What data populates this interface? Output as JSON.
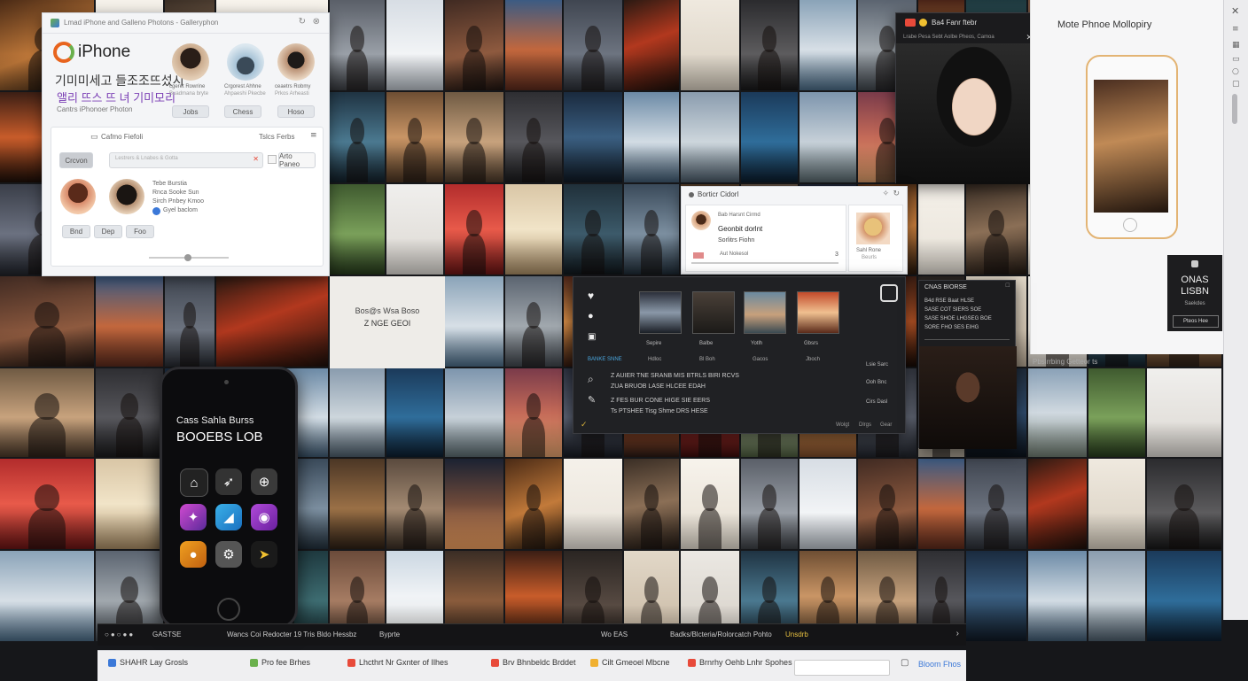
{
  "colors": {
    "accent_orange": "#e8641e",
    "accent_green": "#6ab04c",
    "purple_text": "#7b3fb5",
    "blue_link": "#3b78d8",
    "panel_white": "#f4f5f7",
    "panel_dark": "#222326"
  },
  "tiles": [
    {
      "bg": "linear-gradient(160deg,#4a2a15,#c27a3a 55%,#2a1a0e)",
      "subj": "body"
    },
    {
      "bg": "linear-gradient(180deg,#f5f1ea,#e8e2d8)",
      "subj": "none"
    },
    {
      "bg": "linear-gradient(170deg,#3a2e25,#8b6f56 50%,#231a14)",
      "subj": "body"
    },
    {
      "bg": "linear-gradient(180deg,#f7f3ec,#e5ddd0)",
      "subj": "body"
    },
    {
      "bg": "linear-gradient(180deg,#5a5f68,#9aa0a8 60%,#3c3f44)",
      "subj": "body"
    },
    {
      "bg": "linear-gradient(180deg,#d7dde4,#f2f4f6 60%,#b9c0c8)",
      "subj": "none"
    },
    {
      "bg": "linear-gradient(170deg,#402a22,#8e5a3f 60%,#1f1410)",
      "subj": "body"
    },
    {
      "bg": "linear-gradient(180deg,#3c5b83,#c2673d 55%,#5b2a1c)",
      "subj": "none"
    },
    {
      "bg": "linear-gradient(180deg,#404651,#6d7480 60%,#2b2f36)",
      "subj": "body"
    },
    {
      "bg": "linear-gradient(160deg,#2a1912,#b2381e 45%,#1b0f0a)",
      "subj": "none"
    },
    {
      "bg": "linear-gradient(180deg,#efe9df,#d8cfc0)",
      "subj": "none"
    },
    {
      "bg": "linear-gradient(180deg,#2b2b2e,#5d5c5e 60%,#171718)",
      "subj": "body"
    },
    {
      "bg": "linear-gradient(180deg,#8aa3b8,#d7dfe6 55%,#4a6b86)",
      "subj": "none"
    },
    {
      "bg": "linear-gradient(180deg,#5b6470,#a1a8ae 55%,#40464d)",
      "subj": "body"
    },
    {
      "bg": "linear-gradient(180deg,#4a2418,#d38a45 50%,#3b1d12)",
      "subj": "none"
    },
    {
      "bg": "linear-gradient(180deg,#1f3a40,#3e6d72 55%,#0f2125)",
      "subj": "body"
    },
    {
      "bg": "linear-gradient(180deg,#6b4b3a,#a67c63 55%,#3a2a20)",
      "subj": "body"
    },
    {
      "bg": "linear-gradient(180deg,#cbd7e2,#f0f3f6 50%,#e3e5e4)",
      "subj": "none"
    },
    {
      "bg": "linear-gradient(180deg,#3a2d25,#8a5c3c 55%,#2a1e17)",
      "subj": "none"
    },
    {
      "bg": "linear-gradient(180deg,#3b1e14,#c85c2a 50%,#1c0e08)",
      "subj": "none"
    },
    {
      "bg": "linear-gradient(180deg,#2a2522,#574a42 60%,#1a1512)",
      "subj": "body"
    },
    {
      "bg": "linear-gradient(180deg,#e2d8c8,#c8b8a3)",
      "subj": "body"
    },
    {
      "bg": "linear-gradient(180deg,#ebe8e3,#d6d0c7)",
      "subj": "body"
    },
    {
      "bg": "linear-gradient(180deg,#1f3342,#4b7990 55%,#13202a)",
      "subj": "body"
    },
    {
      "bg": "linear-gradient(180deg,#6e4e33,#c99565 50%,#4b3522)",
      "subj": "body"
    },
    {
      "bg": "linear-gradient(180deg,#6f5a43,#c7a27d 55%,#4a3828)",
      "subj": "body"
    },
    {
      "bg": "linear-gradient(180deg,#2e2e32,#57575c 55%,#1a1a1c)",
      "subj": "body"
    },
    {
      "bg": "linear-gradient(180deg,#1a2a3e,#3a5e80 50%,#0f1924)",
      "subj": "none"
    },
    {
      "bg": "linear-gradient(180deg,#6c8aa6,#d2dce4 55%,#3f5a72)",
      "subj": "none"
    },
    {
      "bg": "linear-gradient(180deg,#8a9cae,#cdd6dc 55%,#4c5d6b)",
      "subj": "none"
    },
    {
      "bg": "linear-gradient(180deg,#1b3a5a,#2f6d9a 55%,#0c1d2e)",
      "subj": "none"
    },
    {
      "bg": "linear-gradient(180deg,#7d95ad,#c6d0d8 55%,#5a6a6f)",
      "subj": "none"
    },
    {
      "bg": "linear-gradient(180deg,#7a3b4a,#c46a58 50%,#e0a06c)",
      "subj": "body"
    },
    {
      "bg": "linear-gradient(180deg,#2d3240,#5a6172 55%,#181b22)",
      "subj": "body"
    },
    {
      "bg": "linear-gradient(180deg,#1e3150,#d86a3a 55%,#2a1a15)",
      "subj": "none"
    },
    {
      "bg": "linear-gradient(180deg,#8b1c1c,#d8413a 50%,#3a0d0d)",
      "subj": "body"
    },
    {
      "bg": "linear-gradient(180deg,#7a8a6a,#b5c49d 55%,#4b5a3e)",
      "subj": "body"
    },
    {
      "bg": "linear-gradient(180deg,#c56b33,#f1a65a 45%,#7a4a2a)",
      "subj": "none"
    },
    {
      "bg": "linear-gradient(180deg,#3a3e48,#6b7180 55%,#22252c)",
      "subj": "body"
    },
    {
      "bg": "linear-gradient(180deg,#e3ddd2,#c9bfae)",
      "subj": "body"
    },
    {
      "bg": "linear-gradient(180deg,#1f2b3a,#2f4a6a 50%,#0d141d)",
      "subj": "none"
    },
    {
      "bg": "linear-gradient(180deg,#8aa1b7,#d0d9e0 50%,#6e7b70)",
      "subj": "none"
    },
    {
      "bg": "linear-gradient(180deg,#3f5a2f,#7aa05a 55%,#263a1c)",
      "subj": "none"
    },
    {
      "bg": "linear-gradient(180deg,#f0efed,#dcd8d2)",
      "subj": "none"
    },
    {
      "bg": "linear-gradient(180deg,#b22c2c,#e85a4a 50%,#6a1414)",
      "subj": "body"
    },
    {
      "bg": "linear-gradient(180deg,#d9c6a6,#f1e4c8 50%,#a98c64)",
      "subj": "none"
    },
    {
      "bg": "linear-gradient(180deg,#20303a,#3c5a6a 55%,#12191e)",
      "subj": "body"
    },
    {
      "bg": "linear-gradient(180deg,#3a4a5a,#7c8fa0 55%,#22303c)",
      "subj": "body"
    },
    {
      "bg": "linear-gradient(180deg,#4b3625,#9a7046 55%,#2d2015)",
      "subj": "none"
    },
    {
      "bg": "linear-gradient(180deg,#5a4a3e,#a38a72 55%,#3a2e24)",
      "subj": "body"
    },
    {
      "bg": "linear-gradient(180deg,#1b2232,#6f4a3a 50%,#f0a060)",
      "subj": "none"
    }
  ],
  "left_panel": {
    "title_bar": "Lmad iPhone and Galleno Photons - Galleryphon",
    "logo_text": "iPhone",
    "heading_1": "기미미세고 들조조뜨섰시",
    "heading_2": "앨리 뜨스 뜨 녀 기미모리",
    "caption": "Cantrs iPhonoer Photon",
    "avatars": [
      {
        "name": "cgeret Rowrine",
        "sub": "Buadmana bryte"
      },
      {
        "name": "Crgorest Ahhne",
        "sub": "Ahpaeshi Pkecbe"
      },
      {
        "name": "ceaetrs Robmy",
        "sub": "Prkos Arheasti"
      }
    ],
    "avatar_buttons": [
      "Jobs",
      "Chess",
      "Hoso"
    ],
    "section_label": "Cafmo Fiefoli",
    "section_right": "Tslcs Ferbs",
    "filter_button": "Crcvon",
    "search_placeholder": "Lestrers & Lnabes & Gotta",
    "search_right": "Arto Paneo",
    "people": [
      {
        "lines": [
          "Tebe Burstia",
          "Rnca Sooke Sun"
        ]
      },
      {
        "lines": [
          "Sirch Pnbey Kmoo",
          "Gyel baclom"
        ]
      }
    ],
    "people_buttons": [
      "Bnd",
      "Dep",
      "Foo"
    ]
  },
  "preview_dark": {
    "tab_title": "Ba4 Fanr ftebr",
    "subtitle": "Lrabe Pesa Sebt Aolbe Pheos, Camoa"
  },
  "right_panel": {
    "title": "Mote Phnoe Mollopiry",
    "badge_line1": "ONAS",
    "badge_line2": "LISBN",
    "badge_sub": "Saekdes",
    "badge_btn": "Pteos Hee",
    "footer_caption": "Pbsirrbing Getteor ts"
  },
  "mid_card": {
    "header": "Borticr Cidorl",
    "top_line": "Bab Harsnt Cirmd",
    "name": "Geonbit dorlnt",
    "role": "Sorlitrs Fiohn",
    "detail": "Aut Nokesol",
    "count": "3",
    "right_name": "Sahl Rone",
    "right_sub": "Beurls"
  },
  "phone_app": {
    "line1": "Cass Sahla Burss",
    "line2": "BOOEBS LOB",
    "icons": [
      "home-icon",
      "rocket-icon",
      "download-icon",
      "sparkle-icon",
      "drop-icon",
      "camera-icon",
      "pumpkin-icon",
      "settings-icon",
      "bird-icon"
    ]
  },
  "editor": {
    "thumbs": [
      {
        "cap": "Sepire"
      },
      {
        "cap": "Balbe"
      },
      {
        "cap": "Yotlh"
      },
      {
        "cap": "Gbsrs"
      }
    ],
    "tabs": [
      "BANKE SNNE",
      "Hdloc",
      "Bl Boh",
      "Gacos",
      "Jboch"
    ],
    "lines": [
      "Z AUIER TNE SRANB MIS BTRLS BIRI RCVS",
      "ZUA BRUOB LASE HLCEE EDAH",
      "Z FES BUR CONE HIGE SIE EERS",
      "Ts PTSHEE Tisg Shme DRS HESE"
    ],
    "right_col": [
      "Lsie Sarc",
      "Ooh Bnc",
      "Cirs Dasl"
    ],
    "footer": [
      "Wolgt",
      "Dlrgs",
      "Gear"
    ]
  },
  "poster": {
    "line1": "Bos@s Wsa Boso",
    "line2": "Z NGE GEOI"
  },
  "dark_chat": {
    "title": "CNAS BIORSE",
    "rows": [
      "B4d RSE Baat HLSE",
      "SASE COT SIERS SOE",
      "SASE SHOE LHGSEG BOE",
      "SORE FHO SES EIHG"
    ]
  },
  "status_bar": {
    "left_label": "GASTSE",
    "mid_label": "Wancs Coi Redocter 19 Tris Bldo Hessbz",
    "mid_right": "Byprte",
    "item_a": "Wo EAS",
    "item_b": "Badks/Blcteria/Rolorcatch Pohto",
    "item_c": "Unsdrb"
  },
  "taskbar": {
    "items": [
      {
        "label": "SHAHR Lay Grosls",
        "color": "#3b78d8"
      },
      {
        "label": "Pro fee Brhes",
        "color": "#6ab04c"
      },
      {
        "label": "Lhcthrt Nr Gxnter of Ilhes",
        "color": "#e84a3a"
      },
      {
        "label": "Brv Bhnbeldc Brddet",
        "color": "#e84a3a"
      },
      {
        "label": "Cilt Gmeoel Mbcne",
        "color": "#f0b030"
      },
      {
        "label": "Brnrhy Oehb Lnhr Spohes",
        "color": "#e84a3a"
      }
    ],
    "search_placeholder": "",
    "right_label": "Bloom Fhos"
  }
}
